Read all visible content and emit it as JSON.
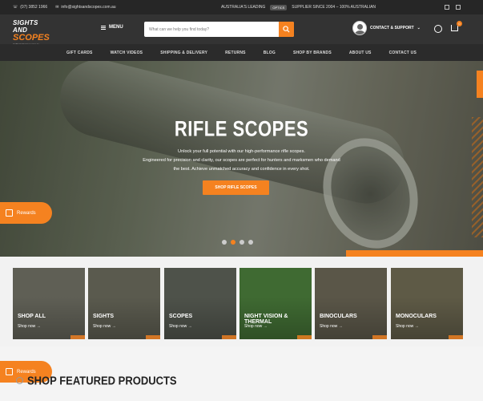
{
  "topbar": {
    "phone": "(07) 3852 1966",
    "email": "info@sightsandscopes.com.au",
    "promo_text": "AUSTRALIA'S LEADING",
    "promo_tag": "OPTICS",
    "promo_tail": "SUPPLIER SINCE 2004 – 100% AUSTRALIAN"
  },
  "header": {
    "logo_line1": "SIGHTS AND",
    "logo_line2": "SCOPES",
    "logo_line3": "sightsandscopes.com.au",
    "menu_label": "MENU",
    "search_placeholder": "What can we help you find today?",
    "support_label": "CONTACT & SUPPORT",
    "cart_count": "0"
  },
  "nav": {
    "items": [
      "Gift Cards",
      "Watch Videos",
      "Shipping & Delivery",
      "Returns",
      "Blog",
      "Shop by Brands",
      "About Us",
      "Contact Us"
    ]
  },
  "hero": {
    "title": "RIFLE SCOPES",
    "desc_line1": "Unlock your full potential with our high-performance rifle scopes.",
    "desc_line2": "Engineered for precision and clarity, our scopes are perfect for hunters and marksmen who demand",
    "desc_line3": "the best. Achieve unmatched accuracy and confidence in every shot.",
    "cta_label": "SHOP RIFLE SCOPES",
    "slides": 4,
    "active_slide": 2
  },
  "rewards": {
    "label": "Rewards"
  },
  "categories": [
    {
      "title": "Shop All",
      "link": "Shop now →",
      "color": "#5f5f55"
    },
    {
      "title": "Sights",
      "link": "Shop now →",
      "color": "#5a5a4e"
    },
    {
      "title": "Scopes",
      "link": "Shop now →",
      "color": "#4e524a"
    },
    {
      "title": "Night Vision & Thermal",
      "link": "Shop now →",
      "color": "#3f6a32"
    },
    {
      "title": "Binoculars",
      "link": "Shop now →",
      "color": "#5a5648"
    },
    {
      "title": "Monoculars",
      "link": "Shop now →",
      "color": "#5e5a46"
    }
  ],
  "featured": {
    "title": "Shop Featured Products"
  },
  "colors": {
    "accent": "#f58220",
    "header": "#333333"
  }
}
